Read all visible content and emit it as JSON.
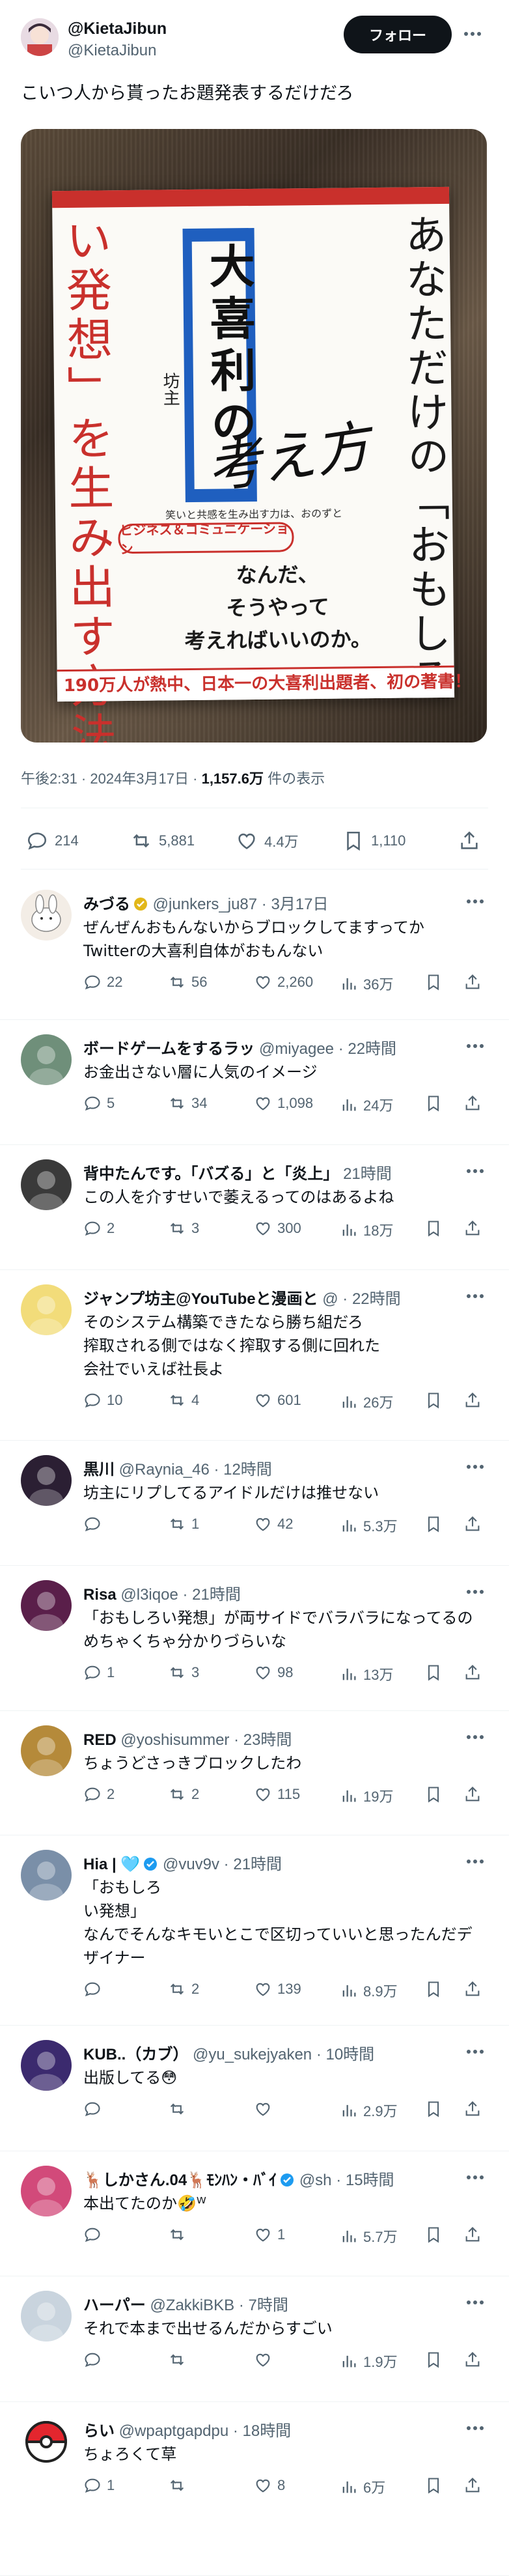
{
  "author": {
    "name": "@KietaJibun",
    "handle": "@KietaJibun",
    "follow_label": "フォロー"
  },
  "post": {
    "text": "こいつ人から貰ったお題発表するだけだろ",
    "time": "午後2:31 · 2024年3月17日 · ",
    "views_value": "1,157.6万",
    "views_suffix": " 件の表示",
    "replies": "214",
    "reposts": "5,881",
    "likes": "4.4万",
    "bookmarks": "1,110"
  },
  "book": {
    "title_right": "あなただけの「おもしろ",
    "title_left": "い発想」を生み出す方法",
    "blue_title": "大喜利の",
    "kangae": "考え方",
    "author_vertical": "坊主",
    "subtitle": "笑いと共感を生み出す力は、おのずと",
    "biz": "ビジネス＆コミュニケーション",
    "question": "なんだ、\nそうやって\n考えればいいのか。",
    "band": "190万人が熱中、日本一の大喜利出題者、初の著書！"
  },
  "replies": [
    {
      "name": "みづる",
      "badge": "gold",
      "handle": "@junkers_ju87 · 3月17日",
      "text": "ぜんぜんおもんないからブロックしてますってかTwitterの大喜利自体がおもんない",
      "c": "22",
      "r": "56",
      "l": "2,260",
      "v": "36万",
      "avatar": "#f3ede6",
      "icon": "rabbit"
    },
    {
      "name": "ボードゲームをするラッ",
      "badge": "",
      "handle": "@miyagee · 22時間",
      "text": "お金出さない層に人気のイメージ",
      "c": "5",
      "r": "34",
      "l": "1,098",
      "v": "24万",
      "avatar": "#6f8f7a",
      "icon": "photo"
    },
    {
      "name": "背中たんです。「バズる」と「炎上」",
      "badge": "",
      "handle": "21時間",
      "text": "この人を介すせいで萎えるってのはあるよね",
      "c": "2",
      "r": "3",
      "l": "300",
      "v": "18万",
      "avatar": "#3a3a3a",
      "icon": "photo"
    },
    {
      "name": "ジャンプ坊主@YouTubeと漫画と",
      "badge": "",
      "handle": "@ · 22時間",
      "text": "そのシステム構築できたなら勝ち組だろ\n搾取される側ではなく搾取する側に回れた\n会社でいえば社長よ",
      "c": "10",
      "r": "4",
      "l": "601",
      "v": "26万",
      "avatar": "#f2dc7a",
      "icon": "photo"
    },
    {
      "name": "黒川",
      "badge": "",
      "handle": "@Raynia_46 · 12時間",
      "text": "坊主にリプしてるアイドルだけは推せない",
      "c": "",
      "r": "1",
      "l": "42",
      "v": "5.3万",
      "avatar": "#2b1f33",
      "icon": "photo"
    },
    {
      "name": "Risa",
      "badge": "",
      "handle": "@l3iqoe · 21時間",
      "text": "「おもしろい発想」が両サイドでバラバラになってるのめちゃくちゃ分かりづらいな",
      "c": "1",
      "r": "3",
      "l": "98",
      "v": "13万",
      "avatar": "#5a1f4a",
      "icon": "photo"
    },
    {
      "name": "RED",
      "badge": "",
      "handle": "@yoshisummer · 23時間",
      "text": "ちょうどさっきブロックしたわ",
      "c": "2",
      "r": "2",
      "l": "115",
      "v": "19万",
      "avatar": "#b58a3a",
      "icon": "photo"
    },
    {
      "name": "Hia | 🩵",
      "badge": "blue",
      "handle": "@vuv9v · 21時間",
      "text": "「おもしろ\nい発想」\nなんでそんなキモいとこで区切っていいと思ったんだデザイナー",
      "c": "",
      "r": "2",
      "l": "139",
      "v": "8.9万",
      "avatar": "#7a8fa8",
      "icon": "photo"
    },
    {
      "name": "KUB..（カブ）",
      "badge": "",
      "handle": "@yu_sukejyaken · 10時間",
      "text": "出版してる😳",
      "c": "",
      "r": "",
      "l": "",
      "v": "2.9万",
      "avatar": "#3b2a6e",
      "icon": "photo"
    },
    {
      "name": "🦌しかさん.04🦌ﾓﾝﾊﾝ・ﾊﾞｲ",
      "badge": "blue",
      "handle": "@sh · 15時間",
      "text": "本出てたのか🤣ᵂ",
      "c": "",
      "r": "",
      "l": "1",
      "v": "5.7万",
      "avatar": "#d24a7a",
      "icon": "photo"
    },
    {
      "name": "ハーパー",
      "badge": "",
      "handle": "@ZakkiBKB · 7時間",
      "text": "それで本まで出せるんだからすごい",
      "c": "",
      "r": "",
      "l": "",
      "v": "1.9万",
      "avatar": "#c9d4de",
      "icon": "photo"
    },
    {
      "name": "らい",
      "badge": "",
      "handle": "@wpaptgapdpu · 18時間",
      "text": "ちょろくて草",
      "c": "1",
      "r": "",
      "l": "8",
      "v": "6万",
      "avatar": "#ffffff",
      "icon": "pokeball"
    }
  ]
}
